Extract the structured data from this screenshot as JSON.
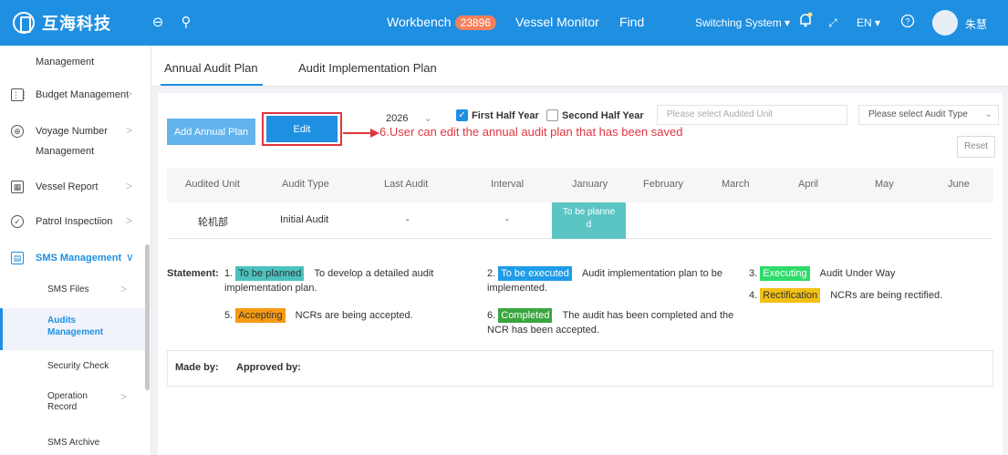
{
  "header": {
    "brand": "互海科技",
    "workbench_label": "Workbench",
    "workbench_count": "23896",
    "vessel_monitor": "Vessel Monitor",
    "find": "Find",
    "switching_system": "Switching System ▾",
    "lang": "EN ▾",
    "user": "朱慧",
    "colors": {
      "bar": "#1e8fe1",
      "badge": "#f47f5b"
    }
  },
  "sidebar": {
    "items": [
      {
        "label": "Management",
        "icon": "none"
      },
      {
        "label": "Budget Management",
        "icon": "grid-icon"
      },
      {
        "label": "Voyage Number",
        "label2": "Management",
        "icon": "globe-icon"
      },
      {
        "label": "Vessel Report",
        "icon": "calendar-icon"
      },
      {
        "label": "Patrol Inspectiion",
        "icon": "check-circle-icon"
      },
      {
        "label": "SMS Management",
        "icon": "document-icon"
      }
    ],
    "sub_items": [
      {
        "label": "SMS Files"
      },
      {
        "label": "Audits",
        "label2": "Management"
      },
      {
        "label": "Security Check"
      },
      {
        "label": "Operation",
        "label2": "Record"
      },
      {
        "label": "SMS Archive"
      }
    ]
  },
  "tabs": [
    {
      "label": "Annual Audit Plan",
      "active": true
    },
    {
      "label": "Audit Implementation Plan",
      "active": false
    }
  ],
  "toolbar": {
    "add_label": "Add Annual Plan",
    "edit_label": "Edit",
    "annotation": "6.User can edit the annual audit plan that has been saved",
    "year": "2026",
    "first_half": "First Half Year",
    "first_half_checked": true,
    "second_half": "Second Half Year",
    "second_half_checked": false,
    "audited_unit_placeholder": "Please select Audited Unit",
    "audit_type_placeholder": "Please select Audit Type",
    "reset_label": "Reset"
  },
  "table": {
    "headers": [
      "Audited Unit",
      "Audit Type",
      "Last Audit",
      "Interval",
      "January",
      "February",
      "March",
      "April",
      "May",
      "June"
    ],
    "row": {
      "unit": "轮机部",
      "type": "Initial Audit",
      "last": "-",
      "interval": "-",
      "january_line1": "To be planne",
      "january_line2": "d"
    }
  },
  "statement": {
    "title": "Statement:",
    "items": [
      {
        "num": "1.",
        "tag": "To be planned",
        "text": "To develop a detailed audit",
        "text2": "implementation plan."
      },
      {
        "num": "2.",
        "tag": "To be executed",
        "text": "Audit implementation plan to be",
        "text2": "implemented."
      },
      {
        "num": "3.",
        "tag": "Executing",
        "text": "Audit Under Way"
      },
      {
        "num": "4.",
        "tag": "Rectification",
        "text": "NCRs are being rectified."
      },
      {
        "num": "5.",
        "tag": "Accepting",
        "text": "NCRs are being accepted."
      },
      {
        "num": "6.",
        "tag": "Completed",
        "text": "The audit has been completed and the",
        "text2": "NCR has been accepted."
      }
    ]
  },
  "footer": {
    "made_by": "Made by:",
    "approved_by": "Approved by:"
  }
}
